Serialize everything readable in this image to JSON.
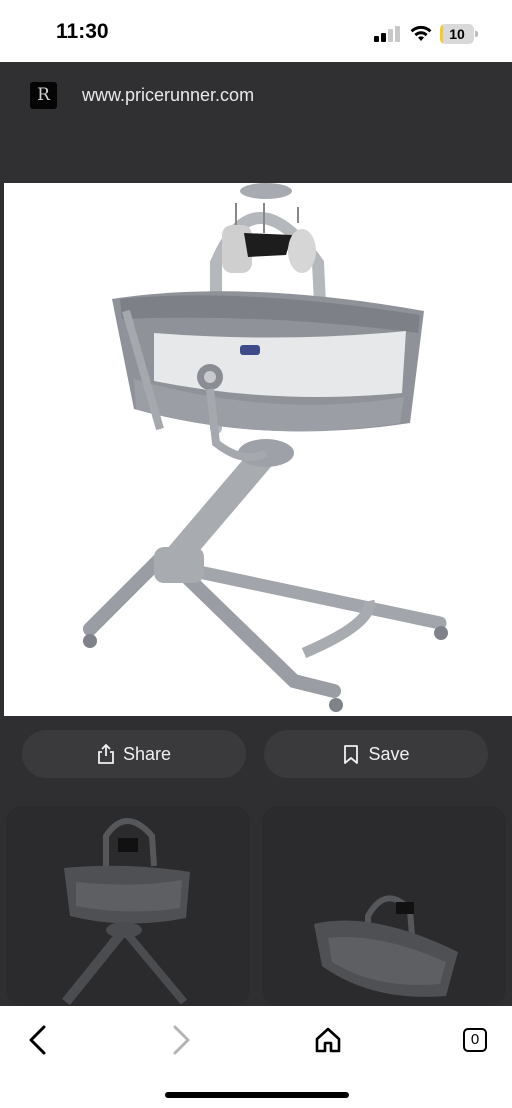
{
  "status_bar": {
    "time": "11:30",
    "battery_level": "10",
    "battery_fraction": 0.1,
    "icons": [
      "cellular-signal-icon",
      "wifi-icon",
      "battery-icon"
    ]
  },
  "browser": {
    "url": "www.pricerunner.com",
    "site_logo_letter": "R",
    "tab_count": "0"
  },
  "product": {
    "image_subject": "baby-bassinet-image"
  },
  "actions": {
    "share_label": "Share",
    "save_label": "Save"
  },
  "toolbar": {
    "icons": [
      "back-icon",
      "forward-icon",
      "home-icon",
      "tabs-icon"
    ]
  },
  "colors": {
    "overlay": "#2f2f31",
    "button_bg": "#3a3a3c",
    "battery_fill": "#f2cc2e",
    "forward_disabled": "#b5b5b5"
  }
}
